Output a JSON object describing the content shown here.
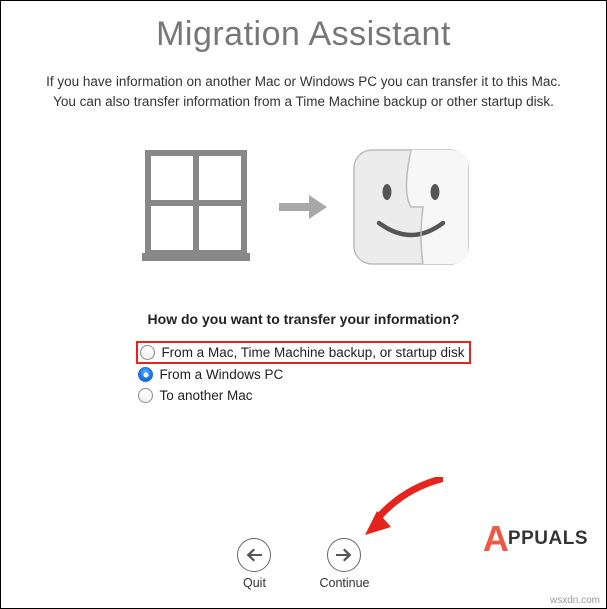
{
  "title": "Migration Assistant",
  "subtitle_line1": "If you have information on another Mac or Windows PC you can transfer it to this Mac.",
  "subtitle_line2": "You can also transfer information from a Time Machine backup or other startup disk.",
  "prompt": "How do you want to transfer your information?",
  "options": [
    {
      "label": "From a Mac, Time Machine backup, or startup disk",
      "selected": false,
      "highlighted": true
    },
    {
      "label": "From a Windows PC",
      "selected": true,
      "highlighted": false
    },
    {
      "label": "To another Mac",
      "selected": false,
      "highlighted": false
    }
  ],
  "nav": {
    "quit": "Quit",
    "continue": "Continue"
  },
  "watermark": {
    "big": "A",
    "rest": "PPUALS"
  },
  "source_credit": "wsxdn.com"
}
